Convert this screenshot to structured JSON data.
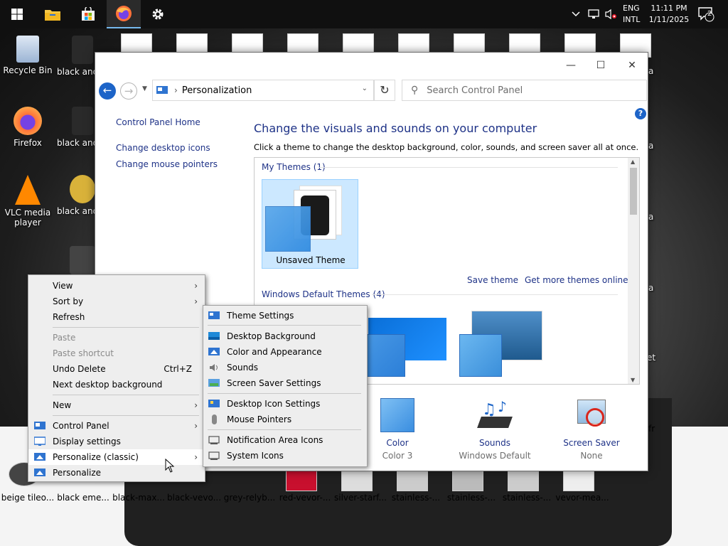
{
  "taskbar": {
    "lang_top": "ENG",
    "lang_bottom": "INTL",
    "time": "11:11 PM",
    "date": "1/11/2025",
    "notification_count": "2"
  },
  "desktop_icons": [
    {
      "label": "Recycle Bin"
    },
    {
      "label": "Firefox"
    },
    {
      "label": "VLC media player"
    }
  ],
  "desktop_column2": [
    "black and",
    "black and",
    "black and"
  ],
  "bottom_files": [
    "beige tileo...",
    "black eme...",
    "black-max...",
    "black-vevo...",
    "grey-relyb...",
    "red-vevor-...",
    "silver-starf...",
    "stainless-...",
    "stainless-...",
    "stainless-...",
    "vevor-mea..."
  ],
  "right_edge_labels": [
    "a",
    "a",
    "a",
    "a",
    "et",
    "fr"
  ],
  "window": {
    "breadcrumb": "Personalization",
    "search_placeholder": "Search Control Panel",
    "left_links": [
      "Control Panel Home",
      "Change desktop icons",
      "Change mouse pointers"
    ],
    "heading": "Change the visuals and sounds on your computer",
    "subheading": "Click a theme to change the desktop background, color, sounds, and screen saver all at once.",
    "my_themes_label": "My Themes (1)",
    "unsaved_theme": "Unsaved Theme",
    "save_theme": "Save theme",
    "get_more_themes": "Get more themes online",
    "default_themes_label": "Windows Default Themes (4)",
    "bottom_items": [
      {
        "label": "Color",
        "sub": "Color 3"
      },
      {
        "label": "Sounds",
        "sub": "Windows Default"
      },
      {
        "label": "Screen Saver",
        "sub": "None"
      }
    ]
  },
  "context_menu": {
    "items": [
      {
        "label": "View",
        "arrow": "›"
      },
      {
        "label": "Sort by",
        "arrow": "›"
      },
      {
        "label": "Refresh"
      },
      {
        "label": "Paste"
      },
      {
        "label": "Paste shortcut"
      },
      {
        "label": "Undo Delete",
        "shortcut": "Ctrl+Z"
      },
      {
        "label": "Next desktop background"
      },
      {
        "label": "New",
        "arrow": "›"
      },
      {
        "label": "Control Panel",
        "arrow": "›"
      },
      {
        "label": "Display settings"
      },
      {
        "label": "Personalize (classic)",
        "arrow": "›"
      },
      {
        "label": "Personalize"
      }
    ]
  },
  "submenu": {
    "items": [
      "Theme Settings",
      "Desktop Background",
      "Color and Appearance",
      "Sounds",
      "Screen Saver Settings",
      "Desktop Icon Settings",
      "Mouse Pointers",
      "Notification Area Icons",
      "System Icons"
    ]
  }
}
